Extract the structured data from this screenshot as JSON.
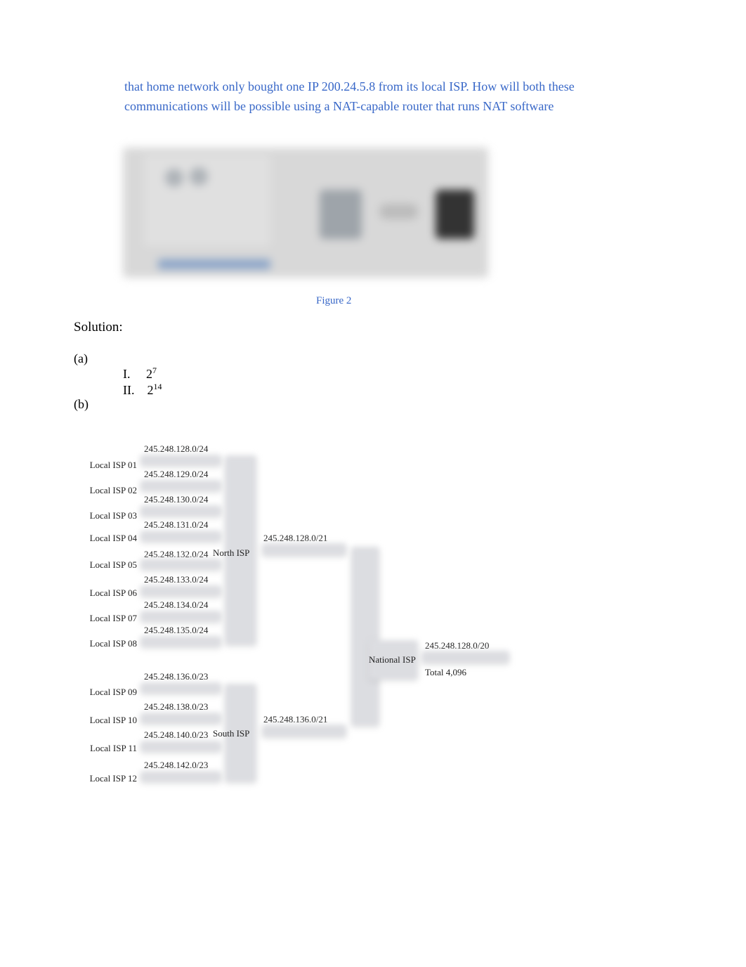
{
  "question": "that home network only bought one IP 200.24.5.8   from its local ISP. How will both these communications will be possible using a NAT-capable router that runs NAT software",
  "figure_caption": "Figure 2",
  "solution_label": "Solution:",
  "part_a_label": "(a)",
  "part_b_label": "(b)",
  "answers": {
    "i_label": "I.",
    "i_base": "2",
    "i_exp": "7",
    "ii_label": "II.",
    "ii_base": "2",
    "ii_exp": "14"
  },
  "local_isps": [
    {
      "name": "Local ISP 01",
      "ip": "245.248.128.0/24"
    },
    {
      "name": "Local ISP 02",
      "ip": "245.248.129.0/24"
    },
    {
      "name": "Local ISP 03",
      "ip": "245.248.130.0/24"
    },
    {
      "name": "Local ISP 04",
      "ip": "245.248.131.0/24"
    },
    {
      "name": "Local ISP 05",
      "ip": "245.248.132.0/24"
    },
    {
      "name": "Local ISP 06",
      "ip": "245.248.133.0/24"
    },
    {
      "name": "Local ISP 07",
      "ip": "245.248.134.0/24"
    },
    {
      "name": "Local ISP 08",
      "ip": "245.248.135.0/24"
    },
    {
      "name": "Local ISP 09",
      "ip": "245.248.136.0/23"
    },
    {
      "name": "Local ISP 10",
      "ip": "245.248.138.0/23"
    },
    {
      "name": "Local ISP 11",
      "ip": "245.248.140.0/23"
    },
    {
      "name": "Local ISP 12",
      "ip": "245.248.142.0/23"
    }
  ],
  "north_isp": {
    "label": "North ISP",
    "ip": "245.248.128.0/21"
  },
  "south_isp": {
    "label": "South ISP",
    "ip": "245.248.136.0/21"
  },
  "national_isp": {
    "label": "National ISP",
    "ip": "245.248.128.0/20",
    "total": "Total 4,096"
  }
}
